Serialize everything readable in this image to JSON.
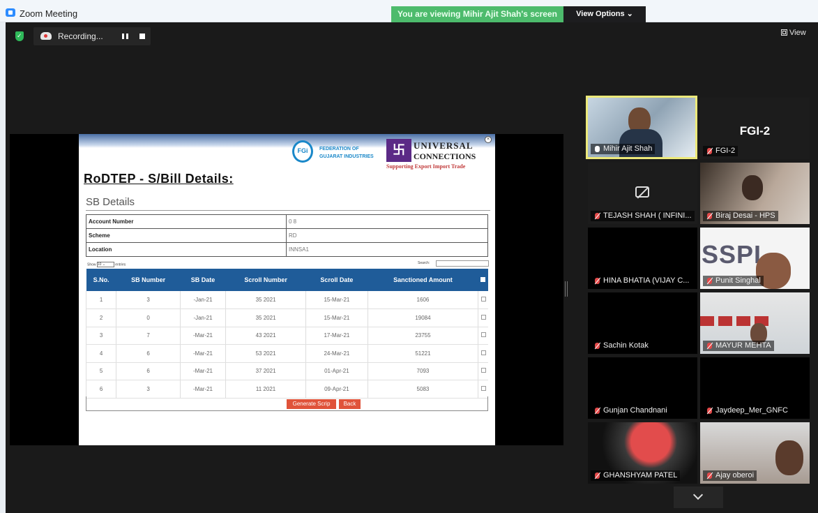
{
  "window": {
    "title": "Zoom Meeting"
  },
  "banner": {
    "viewing": "You are viewing Mihir Ajit Shah's screen",
    "view_options": "View Options ⌄"
  },
  "recording": {
    "label": "Recording..."
  },
  "view_button": {
    "label": "View"
  },
  "shared_doc": {
    "fgi_logo": "FGi",
    "fgi_line1": "FEDERATION OF",
    "fgi_line2": "GUJARAT INDUSTRIES",
    "uc_logo": "卐",
    "uc_line1": "UNIVERSAL",
    "uc_line2": "CONNECTIONS",
    "uc_tagline": "Supporting Export Import Trade",
    "heading": "RoDTEP - S/Bill Details:",
    "section": "SB Details",
    "info": [
      {
        "key": "Account Number",
        "value": "0          8"
      },
      {
        "key": "Scheme",
        "value": "RD"
      },
      {
        "key": "Location",
        "value": "INNSA1"
      }
    ],
    "show_label": "Show",
    "show_value": "10 ⌄",
    "entries_label": "entries",
    "search_label": "Search:",
    "columns": [
      "S.No.",
      "SB Number",
      "SB Date",
      "Scroll Number",
      "Scroll Date",
      "Sanctioned Amount"
    ],
    "rows": [
      {
        "sno": "1",
        "sb_number": "3",
        "sb_date": "-Jan-21",
        "scroll_number": "35   2021",
        "scroll_date": "15-Mar-21",
        "amount": "1606"
      },
      {
        "sno": "2",
        "sb_number": "0",
        "sb_date": "-Jan-21",
        "scroll_number": "35   2021",
        "scroll_date": "15-Mar-21",
        "amount": "19084"
      },
      {
        "sno": "3",
        "sb_number": "7",
        "sb_date": "-Mar-21",
        "scroll_number": "43   2021",
        "scroll_date": "17-Mar-21",
        "amount": "23755"
      },
      {
        "sno": "4",
        "sb_number": "6",
        "sb_date": "-Mar-21",
        "scroll_number": "53   2021",
        "scroll_date": "24-Mar-21",
        "amount": "51221"
      },
      {
        "sno": "5",
        "sb_number": "6",
        "sb_date": "-Mar-21",
        "scroll_number": "37   2021",
        "scroll_date": "01-Apr-21",
        "amount": "7093"
      },
      {
        "sno": "6",
        "sb_number": "3",
        "sb_date": "-Mar-21",
        "scroll_number": "11   2021",
        "scroll_date": "09-Apr-21",
        "amount": "5083"
      }
    ],
    "generate_btn": "Generate Scrip",
    "back_btn": "Back"
  },
  "participants": [
    {
      "name": "Mihir Ajit Shah",
      "muted": false
    },
    {
      "name": "FGI-2",
      "muted": true,
      "tile_text": "FGI-2"
    },
    {
      "name": "TEJASH SHAH ( INFINI...",
      "muted": true
    },
    {
      "name": "Biraj Desai - HPS",
      "muted": true
    },
    {
      "name": "HINA BHATIA (VIJAY C...",
      "muted": true
    },
    {
      "name": "Punit Singhal",
      "muted": true,
      "tile_text": "SSPL"
    },
    {
      "name": "Sachin Kotak",
      "muted": true
    },
    {
      "name": "MAYUR MEHTA",
      "muted": true
    },
    {
      "name": "Gunjan Chandnani",
      "muted": true
    },
    {
      "name": "Jaydeep_Mer_GNFC",
      "muted": true
    },
    {
      "name": "GHANSHYAM PATEL",
      "muted": true
    },
    {
      "name": "Ajay oberoi",
      "muted": true
    }
  ],
  "colors": {
    "green_banner": "#4dbb6c",
    "table_header": "#1f5c99",
    "action_button": "#e0533a",
    "active_speaker": "#ece97a"
  }
}
